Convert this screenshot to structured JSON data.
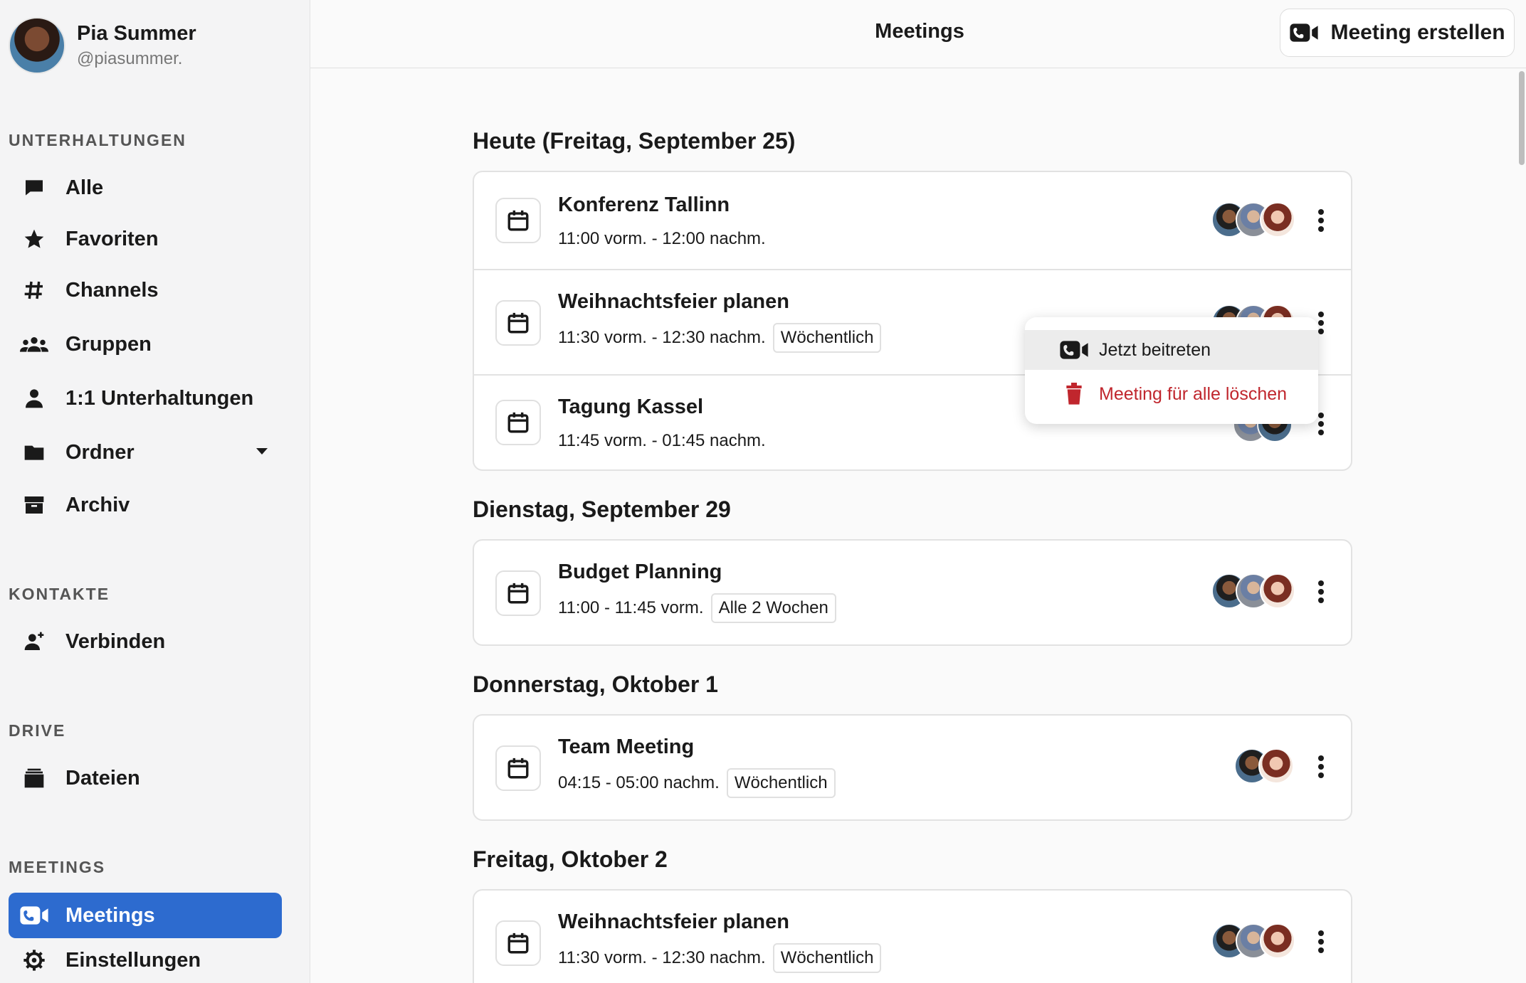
{
  "profile": {
    "name": "Pia Summer",
    "handle": "@piasummer."
  },
  "sidebar": {
    "conversations_label": "UNTERHALTUNGEN",
    "conversations": [
      {
        "label": "Alle",
        "icon": "chat-bubble-icon"
      },
      {
        "label": "Favoriten",
        "icon": "star-icon"
      },
      {
        "label": "Channels",
        "icon": "hashtag-icon"
      },
      {
        "label": "Gruppen",
        "icon": "group-icon"
      },
      {
        "label": "1:1 Unterhaltungen",
        "icon": "person-icon"
      },
      {
        "label": "Ordner",
        "icon": "folder-icon"
      },
      {
        "label": "Archiv",
        "icon": "archive-icon"
      }
    ],
    "contacts_label": "KONTAKTE",
    "contacts": [
      {
        "label": "Verbinden",
        "icon": "add-person-icon"
      }
    ],
    "drive_label": "DRIVE",
    "drive": [
      {
        "label": "Dateien",
        "icon": "files-icon"
      }
    ],
    "meetings_label": "MEETINGS",
    "meetings": [
      {
        "label": "Meetings",
        "icon": "video-call-icon",
        "active": true
      },
      {
        "label": "Einstellungen",
        "icon": "gear-icon"
      }
    ]
  },
  "header": {
    "title": "Meetings",
    "create_label": "Meeting erstellen"
  },
  "days": [
    {
      "heading": "Heute (Freitag, September 25)",
      "meetings": [
        {
          "title": "Konferenz Tallinn",
          "time": "11:00 vorm. - 12:00 nachm.",
          "badge": ""
        },
        {
          "title": "Weihnachtsfeier planen",
          "time": "11:30 vorm. - 12:30 nachm.",
          "badge": "Wöchentlich"
        },
        {
          "title": "Tagung Kassel",
          "time": "11:45 vorm. - 01:45 nachm.",
          "badge": ""
        }
      ]
    },
    {
      "heading": "Dienstag, September 29",
      "meetings": [
        {
          "title": "Budget Planning",
          "time": "11:00 - 11:45 vorm.",
          "badge": "Alle 2 Wochen"
        }
      ]
    },
    {
      "heading": "Donnerstag, Oktober 1",
      "meetings": [
        {
          "title": "Team Meeting",
          "time": "04:15 - 05:00 nachm.",
          "badge": "Wöchentlich"
        }
      ]
    },
    {
      "heading": "Freitag, Oktober 2",
      "meetings": [
        {
          "title": "Weihnachtsfeier planen",
          "time": "11:30 vorm. - 12:30 nachm.",
          "badge": "Wöchentlich"
        }
      ]
    }
  ],
  "popup": {
    "join_label": "Jetzt beitreten",
    "delete_label": "Meeting für alle löschen"
  },
  "colors": {
    "accent": "#2d6bcf",
    "danger": "#c0262d"
  }
}
